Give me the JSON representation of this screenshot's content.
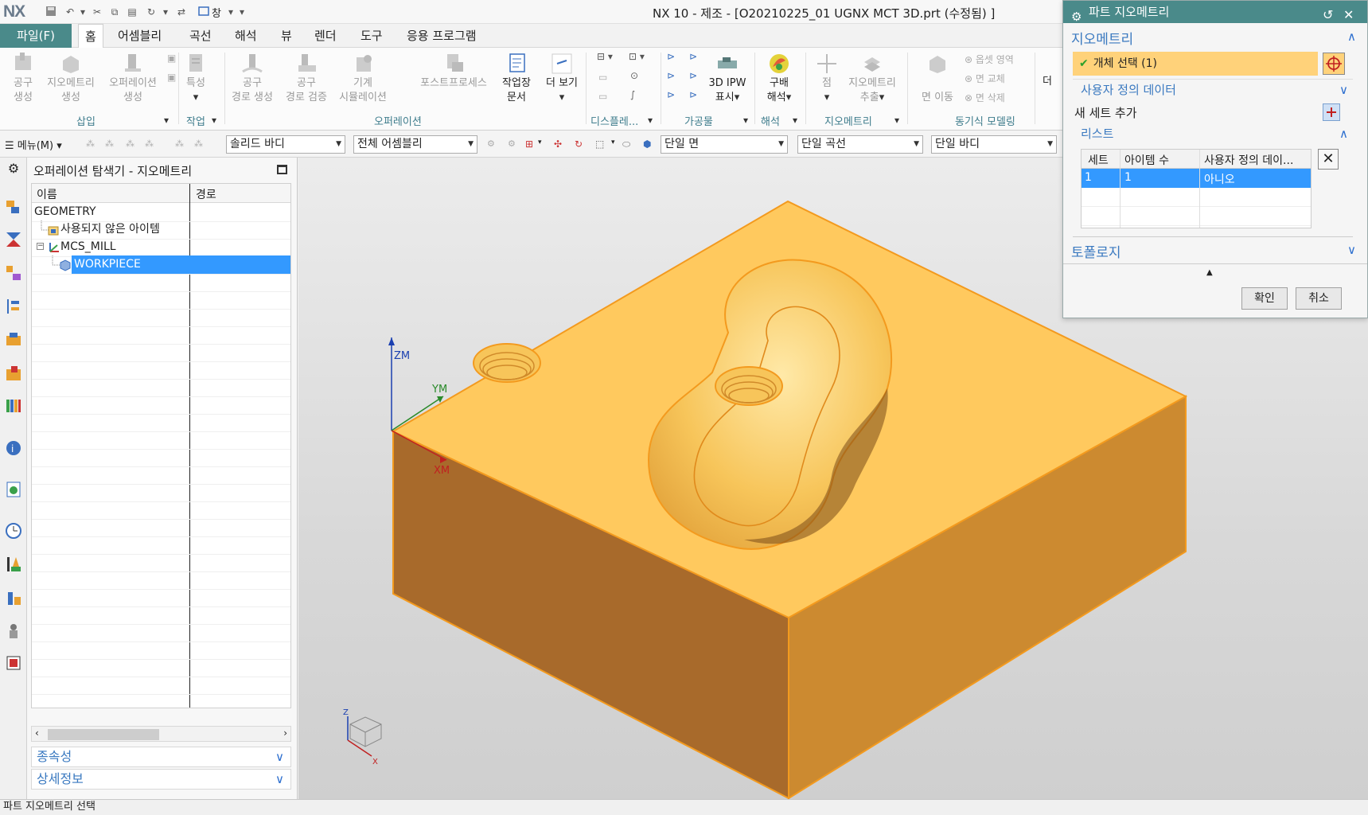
{
  "app": {
    "logo": "NX",
    "window_title": "NX 10 - 제조 - [O20210225_01 UGNX MCT 3D.prt (수정됨) ]",
    "window_menu": "창"
  },
  "ribbon": {
    "file_tab": "파일(F)",
    "tabs": [
      "홈",
      "어셈블리",
      "곡선",
      "해석",
      "뷰",
      "렌더",
      "도구",
      "응용 프로그램"
    ],
    "active_tab": "홈",
    "groups": {
      "insert": {
        "label": "삽입",
        "buttons": [
          {
            "line1": "공구",
            "line2": "생성"
          },
          {
            "line1": "지오메트리",
            "line2": "생성"
          },
          {
            "line1": "오퍼레이션",
            "line2": "생성"
          }
        ]
      },
      "work": {
        "label": "작업",
        "buttons": [
          {
            "line1": "특성"
          }
        ]
      },
      "operation": {
        "label": "오퍼레이션",
        "buttons": [
          {
            "line1": "공구",
            "line2": "경로 생성"
          },
          {
            "line1": "공구",
            "line2": "경로 검증"
          },
          {
            "line1": "기계",
            "line2": "시뮬레이션"
          },
          {
            "line1": "포스트프로세스"
          },
          {
            "line1": "작업장",
            "line2": "문서"
          },
          {
            "line1": "더 보기"
          }
        ]
      },
      "display": {
        "label": "디스플레..."
      },
      "workpiece": {
        "label": "가공물",
        "buttons": [
          {
            "line1": "3D IPW",
            "line2": "표시"
          }
        ]
      },
      "analysis": {
        "label": "해석",
        "buttons": [
          {
            "line1": "구배",
            "line2": "해석"
          }
        ]
      },
      "geometry": {
        "label": "지오메트리",
        "buttons": [
          {
            "line1": "점"
          },
          {
            "line1": "지오메트리",
            "line2": "추출"
          }
        ]
      },
      "sync": {
        "label": "동기식 모델링",
        "buttons": [
          {
            "line1": "면 이동"
          }
        ],
        "small": [
          "옵셋 영역",
          "면 교체",
          "면 삭제"
        ]
      },
      "more_cut": "더"
    }
  },
  "seltoolbar": {
    "menu": "메뉴(M)",
    "filter1": "솔리드 바디",
    "filter2": "전체 어셈블리",
    "rule1": "단일 면",
    "rule2": "단일 곡선",
    "rule3": "단일 바디"
  },
  "navigator": {
    "title": "오퍼레이션 탐색기 - 지오메트리",
    "columns": [
      "이름",
      "경로"
    ],
    "rows": [
      {
        "label": "GEOMETRY",
        "indent": 0,
        "selected": false
      },
      {
        "label": "사용되지 않은 아이템",
        "indent": 1,
        "selected": false
      },
      {
        "label": "MCS_MILL",
        "indent": 1,
        "selected": false
      },
      {
        "label": "WORKPIECE",
        "indent": 2,
        "selected": true
      }
    ],
    "sections": [
      "종속성",
      "상세정보"
    ]
  },
  "viewport": {
    "axis_z": "ZM",
    "axis_y": "YM",
    "axis_x": "XM",
    "triad_z": "Z",
    "triad_x": "X",
    "colors": {
      "top": "#ffc95e",
      "left": "#a86a2b",
      "right": "#cc8a30",
      "edge": "#f39a1e"
    }
  },
  "dialog": {
    "title": "파트 지오메트리",
    "geometry_section": "지오메트리",
    "select_object": "개체 선택 (1)",
    "user_defined": "사용자 정의 데이터",
    "add_new_set": "새 세트 추가",
    "list_section": "리스트",
    "list_columns": [
      "세트",
      "아이템 수",
      "사용자 정의 데이..."
    ],
    "list_rows": [
      {
        "set": "1",
        "count": "1",
        "user": "아니오"
      }
    ],
    "topology_section": "토폴로지",
    "ok": "확인",
    "cancel": "취소"
  },
  "status": {
    "text": "파트 지오메트리 선택"
  }
}
